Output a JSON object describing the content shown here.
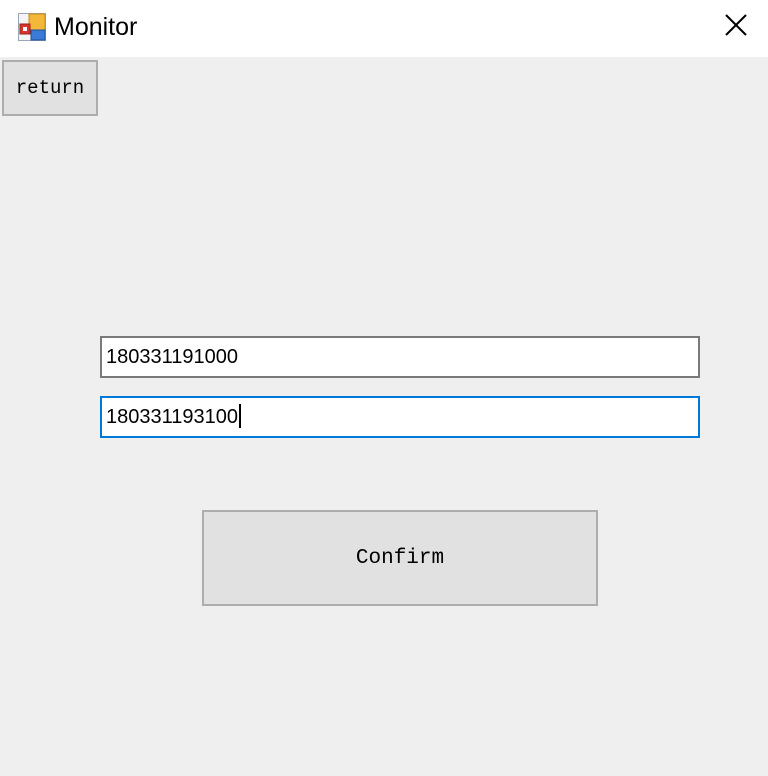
{
  "window": {
    "title": "Monitor",
    "icon": "app-window-icon",
    "close_icon": "close-icon"
  },
  "toolbar": {
    "return_label": "return"
  },
  "form": {
    "start_value": "180331191000",
    "end_value": "180331193100",
    "confirm_label": "Confirm"
  },
  "colors": {
    "background": "#efefef",
    "titlebar": "#ffffff",
    "button_face": "#e1e1e1",
    "button_border": "#adadad",
    "focus_border": "#0078d7",
    "input_border": "#7a7a7a"
  }
}
